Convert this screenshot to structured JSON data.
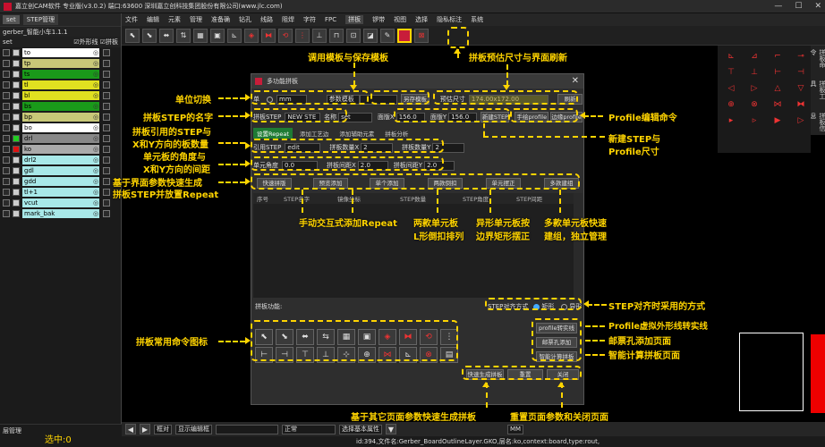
{
  "window": {
    "title": "嘉立创CAM软件 专业版(v3.0.2) 端口:63600    深圳嘉立创科技集团股份有限公司(www.jlc.com)",
    "controls": [
      "—",
      "☐",
      "✕"
    ]
  },
  "left_panel": {
    "tabs": [
      "set",
      "STEP管理"
    ],
    "job_name": "gerber_智能小车1.1.1",
    "header": {
      "set_label": "set",
      "outline_label": "外形线",
      "panel_label": "拼板"
    },
    "layers": [
      {
        "name": "to",
        "bg": "#ffffff",
        "sw": "#cccccc"
      },
      {
        "name": "tp",
        "bg": "#c8c878",
        "sw": "#cccccc"
      },
      {
        "name": "ts",
        "bg": "#1a9a1a",
        "sw": "#cccccc"
      },
      {
        "name": "tl",
        "bg": "#e0e020",
        "sw": "#cccccc"
      },
      {
        "name": "bl",
        "bg": "#e0e020",
        "sw": "#cccccc"
      },
      {
        "name": "bs",
        "bg": "#1a9a1a",
        "sw": "#cccccc"
      },
      {
        "name": "bp",
        "bg": "#c8c878",
        "sw": "#cccccc"
      },
      {
        "name": "bo",
        "bg": "#ffffff",
        "sw": "#cccccc"
      },
      {
        "name": "drl",
        "bg": "#888888",
        "sw": "#22cc22"
      },
      {
        "name": "ko",
        "bg": "#aaaaaa",
        "sw": "#dd1111"
      },
      {
        "name": "drl2",
        "bg": "#a8e8e8",
        "sw": "#cccccc"
      },
      {
        "name": "gdl",
        "bg": "#a8e8e8",
        "sw": "#cccccc"
      },
      {
        "name": "gdd",
        "bg": "#a8e8e8",
        "sw": "#cccccc"
      },
      {
        "name": "tl+1",
        "bg": "#a8e8e8",
        "sw": "#cccccc"
      },
      {
        "name": "vcut",
        "bg": "#a8e8e8",
        "sw": "#cccccc"
      },
      {
        "name": "mark_bak",
        "bg": "#a8e8e8",
        "sw": "#cccccc"
      }
    ],
    "bottom_tab": "层管理",
    "selection": "选中:0"
  },
  "menu": [
    "文件",
    "编辑",
    "元素",
    "管理",
    "准备确",
    "钻孔",
    "线路",
    "阻焊",
    "字符",
    "FPC",
    "拼板",
    "锣带",
    "视图",
    "选择",
    "隐私标注",
    "系统"
  ],
  "menu_active": "拼板",
  "right_tabs": [
    "拼板命令",
    "拼板工具",
    "拼板信息"
  ],
  "dialog": {
    "title": "多功能拼板",
    "unit_label": "单",
    "unit_value": "mm",
    "template_label": "参数模板",
    "save_template": "另存模板",
    "estimate_label": "预估尺寸",
    "estimate_value": "174.00x172.00",
    "refresh": "刷新",
    "step_label": "拼板STEP",
    "step_value": "NEW STE",
    "name_label": "名称",
    "name_value": "set",
    "width_label": "面版X",
    "width_value": "156.0",
    "height_label": "面版Y",
    "height_value": "156.0",
    "new_step": "新建STEP",
    "manual_profile": "手绘profile",
    "edge_profile": "边缘profile",
    "tabs": [
      "设置Repeat",
      "添加工艺边",
      "添加辅助元素",
      "拼板分析"
    ],
    "ref_step_label": "引用STEP",
    "ref_step_value": "edit",
    "count_x_label": "拼板数量X",
    "count_x_value": "2",
    "count_y_label": "拼板数量Y",
    "count_y_value": "2",
    "angle_label": "单元角度",
    "angle_value": "0.0",
    "gap_x_label": "拼板间距X",
    "gap_x_value": "2.0",
    "gap_y_label": "拼板间距Y",
    "gap_y_value": "2.0",
    "quick_buttons": [
      "快速拼版",
      "预览添加",
      "单个添加",
      "两款倒扣",
      "单元摆正",
      "多款建组"
    ],
    "table_headers": [
      "序号",
      "STEP名字",
      "镜像坐标",
      "STEP数量",
      "STEP角度",
      "STEP间距"
    ],
    "cmd_label": "拼板功能:",
    "align_label": "STEP对齐方式",
    "align_options": [
      "矩形",
      "异形"
    ],
    "profile_line": "profile转实线",
    "stamp_hole": "邮票孔添加",
    "smart_calc": "智能计算拼板",
    "quick_gen": "快速生成拼板",
    "reset": "重置",
    "close": "关闭"
  },
  "annotations": {
    "template": "调用模板与保存模板",
    "estimate": "拼板预估尺寸与界面刷新",
    "unit": "单位切换",
    "step_name": "拼板STEP的名字",
    "profile_cmd": "Profile编辑命令",
    "ref_step_1": "拼板引用的STEP与",
    "ref_step_2": "X和Y方向的板数量",
    "new_step_1": "新建STEP与",
    "new_step_2": "Profile尺寸",
    "angle_1": "单元板的角度与",
    "angle_2": "X和Y方向的间距",
    "quick_1": "基于界面参数快速生成",
    "quick_2": "拼板STEP并放置Repeat",
    "manual_add": "手动交互式添加Repeat",
    "two_1": "两款单元板",
    "two_2": "L形倒扣排列",
    "shaped_1": "异形单元板按",
    "shaped_2": "边界矩形摆正",
    "multi_1": "多款单元板快速",
    "multi_2": "建组，独立管理",
    "align": "STEP对齐时采用的方式",
    "profile_line": "Profile虚拟外形线转实线",
    "stamp": "邮票孔添加页面",
    "smart": "智能计算拼板页面",
    "icons": "拼板常用命令图标",
    "quick_gen": "基于其它页面参数快速生成拼板",
    "reset": "重置页面参数和关闭页面"
  },
  "status": {
    "mode": "框对",
    "show_box": "显示编辑框",
    "normal": "正常",
    "filter": "选择基本属性",
    "unit": "MM",
    "info": "id:394,文件名:Gerber_BoardOutlineLayer.GKO,层名:ko,context:board,type:rout,"
  }
}
